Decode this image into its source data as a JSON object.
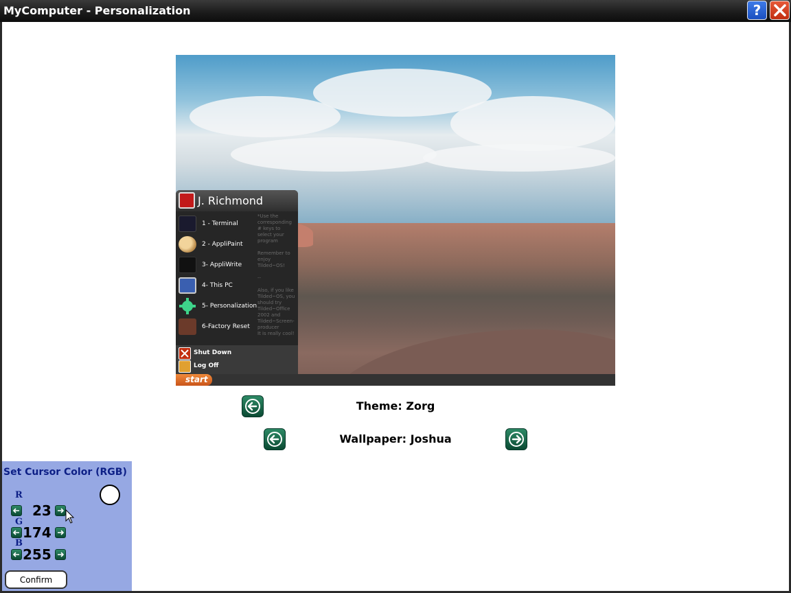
{
  "window": {
    "title": "MyComputer - Personalization",
    "help_label": "?"
  },
  "preview": {
    "user_name": "J. Richmond",
    "menu_items": [
      {
        "label": "1 - Terminal",
        "icon": "terminal-icon"
      },
      {
        "label": "2 - AppliPaint",
        "icon": "palette-icon"
      },
      {
        "label": "3- AppliWrite",
        "icon": "document-icon"
      },
      {
        "label": "4- This PC",
        "icon": "computer-icon"
      },
      {
        "label": "5- Personalization",
        "icon": "gear-icon"
      },
      {
        "label": "6-Factory Reset",
        "icon": "briefcase-icon"
      }
    ],
    "tips": "*Use the corresponding # keys to select your program\n\nRemember to enjoy Tilded~OS!\n\n--\n\nAlso, if you like Tilded~OS, you should try Tilded~Office 2002 and Tilded~Screen-producer\nIt is really cool!",
    "shutdown_label": "Shut Down",
    "logoff_label": "Log Off",
    "start_label": "start"
  },
  "theme": {
    "label": "Theme: Zorg"
  },
  "wallpaper": {
    "label": "Wallpaper: Joshua"
  },
  "cursor_panel": {
    "title": "Set Cursor Color (RGB)",
    "r_label": "R",
    "g_label": "G",
    "b_label": "B",
    "r_value": "23",
    "g_value": "174",
    "b_value": "255",
    "swatch_color": "#ffffff",
    "confirm_label": "Confirm"
  },
  "colors": {
    "nav_button": "#1f6b4e",
    "panel_bg": "#96a8e3",
    "panel_text": "#0d1f86"
  }
}
